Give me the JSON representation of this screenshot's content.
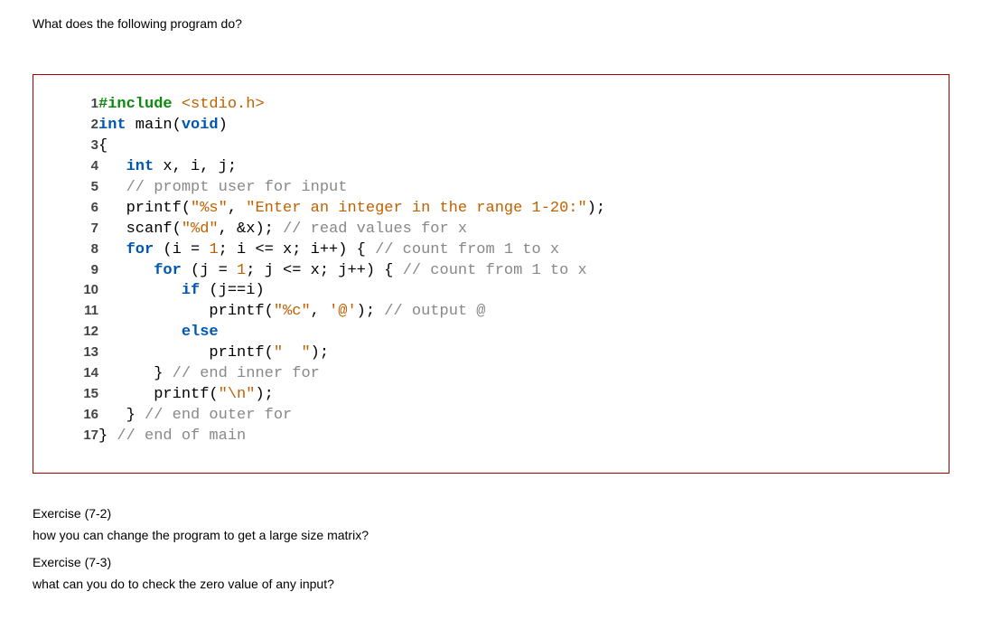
{
  "question": "What does the following program do?",
  "code": {
    "lines": [
      {
        "n": "1",
        "html": "<span class='pp'>#include</span> <span class='str'>&lt;stdio.h&gt;</span>"
      },
      {
        "n": "2",
        "html": "<span class='ty'>int</span> main(<span class='ty'>void</span>)"
      },
      {
        "n": "3",
        "html": "{"
      },
      {
        "n": "4",
        "html": "   <span class='ty'>int</span> x, i, j;"
      },
      {
        "n": "5",
        "html": "   <span class='cmt'>// prompt user for input</span>"
      },
      {
        "n": "6",
        "html": "   printf(<span class='str'>\"%s\"</span>, <span class='str'>\"Enter an integer in the range 1-20:\"</span>);"
      },
      {
        "n": "7",
        "html": "   scanf(<span class='str'>\"%d\"</span>, &amp;x); <span class='cmt'>// read values for x</span>"
      },
      {
        "n": "8",
        "html": "   <span class='kw'>for</span> (i = <span class='num'>1</span>; i &lt;= x; i++) { <span class='cmt'>// count from 1 to x</span>"
      },
      {
        "n": "9",
        "html": "      <span class='kw'>for</span> (j = <span class='num'>1</span>; j &lt;= x; j++) { <span class='cmt'>// count from 1 to x</span>"
      },
      {
        "n": "10",
        "html": "         <span class='kw'>if</span> (j==i)"
      },
      {
        "n": "11",
        "html": "            printf(<span class='str'>\"%c\"</span>, <span class='str'>'@'</span>); <span class='cmt'>// output @</span>"
      },
      {
        "n": "12",
        "html": "         <span class='kw'>else</span>"
      },
      {
        "n": "13",
        "html": "            printf(<span class='str'>\"  \"</span>);"
      },
      {
        "n": "14",
        "html": "      } <span class='cmt'>// end inner for</span>"
      },
      {
        "n": "15",
        "html": "      printf(<span class='str'>\"\\n\"</span>);"
      },
      {
        "n": "16",
        "html": "   } <span class='cmt'>// end outer for</span>"
      },
      {
        "n": "17",
        "html": "} <span class='cmt'>// end of main</span>"
      }
    ]
  },
  "ex1_label": "Exercise (7-2)",
  "ex1_text": "how you can change the program to get a large size matrix?",
  "ex2_label": "Exercise (7-3)",
  "ex2_text": "what can you do to check the zero value of any input?"
}
